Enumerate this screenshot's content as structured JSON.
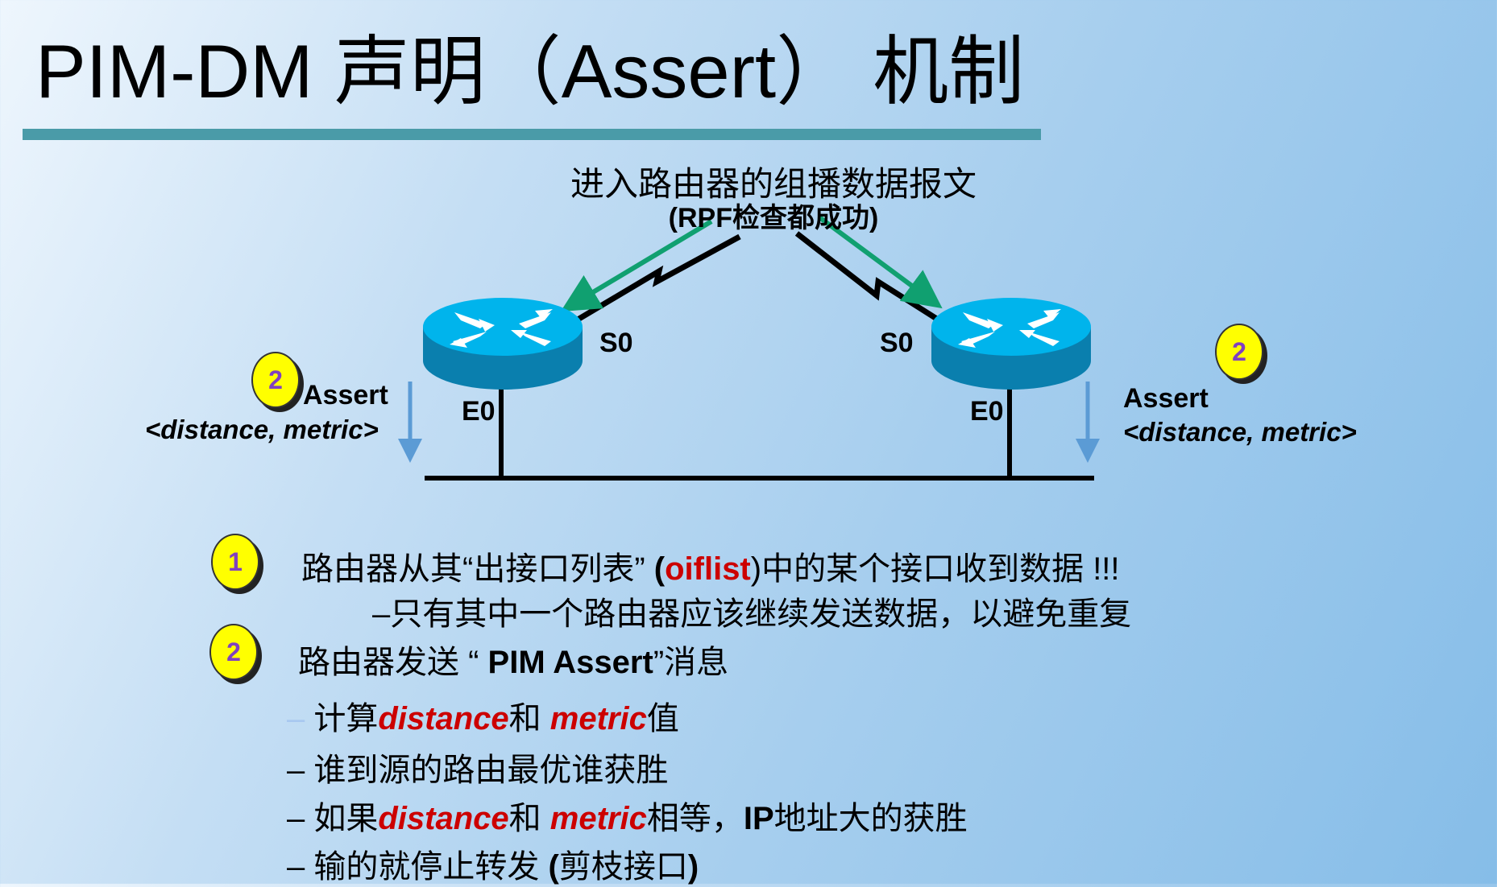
{
  "title": "PIM-DM 声明（Assert） 机制",
  "diagram": {
    "subtitle": "进入路由器的组播数据报文",
    "rpf_note": "(RPF检查都成功)",
    "left_router": {
      "serial": "S0",
      "ethernet": "E0"
    },
    "right_router": {
      "serial": "S0",
      "ethernet": "E0"
    },
    "left_assert": {
      "badge": "2",
      "label": "Assert",
      "params": "<distance, metric>"
    },
    "right_assert": {
      "badge": "2",
      "label": "Assert",
      "params": "<distance, metric>"
    }
  },
  "points": [
    {
      "badge": "1",
      "text_a": "路由器从其“出接口列表” ",
      "paren_open": "(",
      "highlight": "oiflist",
      "text_b": ")中的某个接口收到数据 !!!",
      "sub": "–只有其中一个路由器应该继续发送数据，以避免重复"
    },
    {
      "badge": "2",
      "text_a": "路由器发送 “ ",
      "bold": "PIM Assert",
      "text_b": "”消息"
    }
  ],
  "subitems": [
    {
      "dash": "–",
      "a": "计算",
      "r1": "distance",
      "b": "和 ",
      "r2": "metric",
      "c": "值"
    },
    {
      "dash": "–",
      "a": "谁到源的路由最优谁获胜"
    },
    {
      "dash": "–",
      "a": "如果",
      "r1": "distance",
      "b": "和 ",
      "r2": "metric",
      "c": "相等，",
      "bold": "IP",
      "d": "地址大的获胜"
    },
    {
      "dash": "–",
      "a": "输的就停止转发 ",
      "bold": "(",
      "d": "剪枝接口",
      "e": ")"
    }
  ],
  "colors": {
    "accent_bar": "#4a9ba8",
    "router_top": "#00b4ec",
    "router_body": "#0a7fae",
    "flow_arrow": "#10a070",
    "highlight": "#cc0000",
    "badge": "#ffff00"
  }
}
